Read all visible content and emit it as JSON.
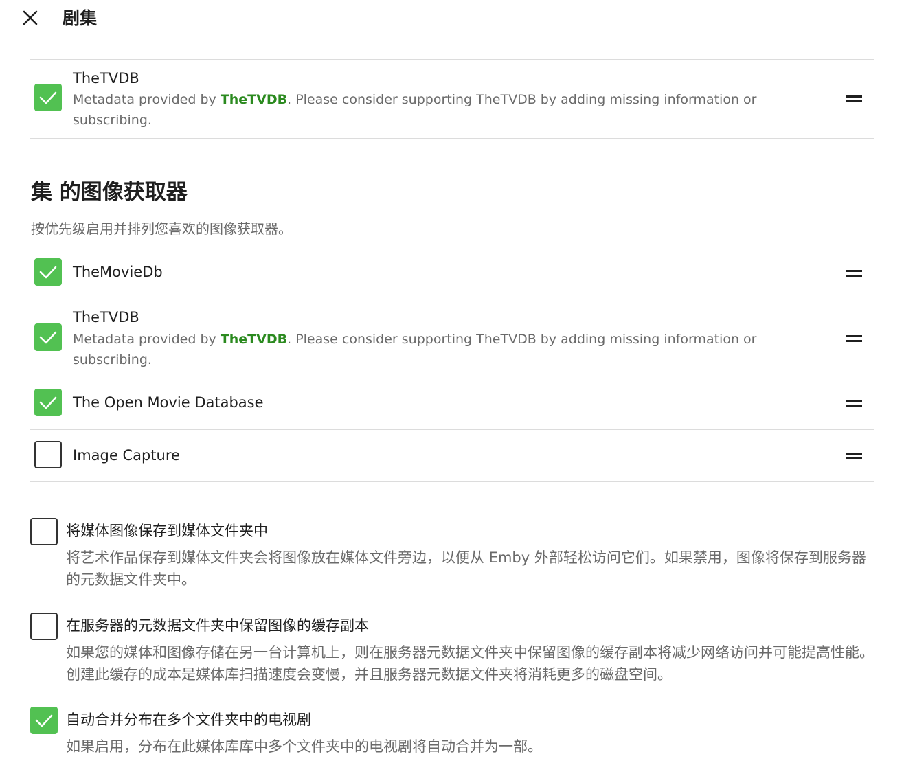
{
  "header": {
    "title": "剧集"
  },
  "metadata_fetchers": {
    "items": [
      {
        "name": "TheTVDB",
        "checked": true,
        "desc_prefix": "Metadata provided by ",
        "desc_brand": "TheTVDB",
        "desc_suffix": ". Please consider supporting TheTVDB by adding missing information or subscribing."
      }
    ]
  },
  "image_fetchers": {
    "title": "集 的图像获取器",
    "description": "按优先级启用并排列您喜欢的图像获取器。",
    "items": [
      {
        "name": "TheMovieDb",
        "checked": true
      },
      {
        "name": "TheTVDB",
        "checked": true,
        "desc_prefix": "Metadata provided by ",
        "desc_brand": "TheTVDB",
        "desc_suffix": ". Please consider supporting TheTVDB by adding missing information or subscribing."
      },
      {
        "name": "The Open Movie Database",
        "checked": true
      },
      {
        "name": "Image Capture",
        "checked": false
      }
    ]
  },
  "options": [
    {
      "label": "将媒体图像保存到媒体文件夹中",
      "checked": false,
      "description": "将艺术作品保存到媒体文件夹会将图像放在媒体文件旁边，以便从 Emby 外部轻松访问它们。如果禁用，图像将保存到服务器的元数据文件夹中。"
    },
    {
      "label": "在服务器的元数据文件夹中保留图像的缓存副本",
      "checked": false,
      "description": "如果您的媒体和图像存储在另一台计算机上，则在服务器元数据文件夹中保留图像的缓存副本将减少网络访问并可能提高性能。创建此缓存的成本是媒体库扫描速度会变慢，并且服务器元数据文件夹将消耗更多的磁盘空间。"
    },
    {
      "label": "自动合并分布在多个文件夹中的电视剧",
      "checked": true,
      "description": "如果启用，分布在此媒体库库中多个文件夹中的电视剧将自动合并为一部。"
    }
  ],
  "colors": {
    "check_green": "#52c152",
    "brand_green": "#2b8a1f",
    "muted_text": "#6a6a6a"
  },
  "icons": {
    "close": "close-icon",
    "check": "checkmark-icon",
    "drag": "drag-handle-icon"
  }
}
